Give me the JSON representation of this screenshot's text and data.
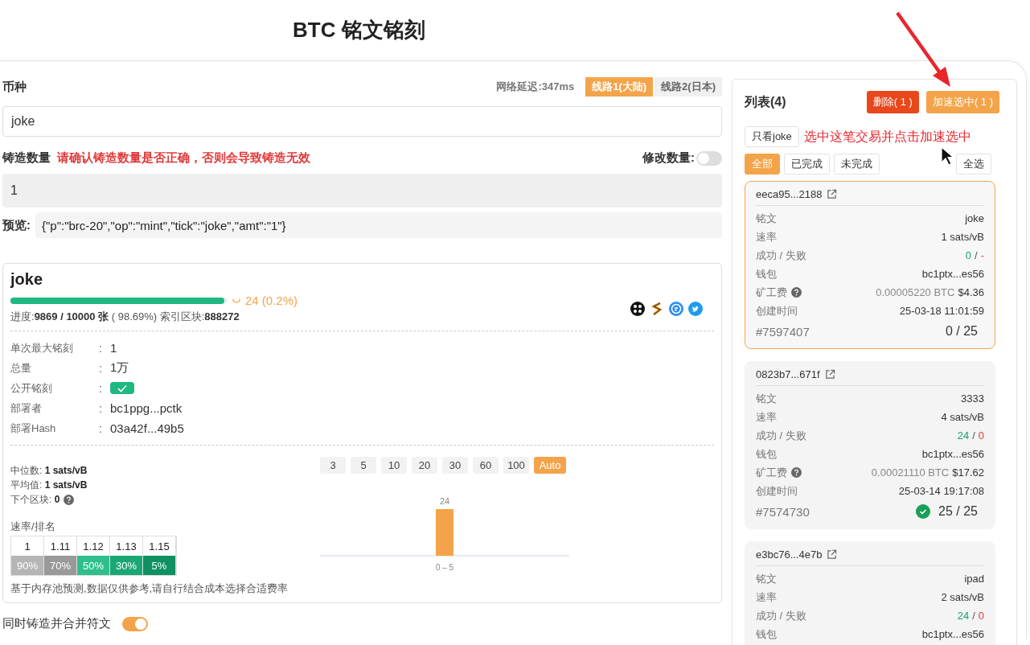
{
  "title": "BTC 铭文铭刻",
  "form": {
    "coin_label": "币种",
    "latency": "网络延迟:347ms",
    "routes": [
      {
        "label": "线路1(大陆)",
        "selected": true
      },
      {
        "label": "线路2(日本)",
        "selected": false
      }
    ],
    "coin_value": "joke",
    "amount_label": "铸造数量",
    "amount_warning": "请确认铸造数量是否正确，否则会导致铸造无效",
    "modify_label": "修改数量:",
    "modify_on": false,
    "amount_value": "1",
    "preview_label": "预览:",
    "preview_value": "{\"p\":\"brc-20\",\"op\":\"mint\",\"tick\":\"joke\",\"amt\":\"1\"}"
  },
  "token": {
    "name": "joke",
    "progress": {
      "level": 0.9869,
      "pending": "24 (0.2%)"
    },
    "progress_text": "进度:**9869 / 10000 张** ( 98.69%)  索引区块:**888272**",
    "details": [
      {
        "kind": "text",
        "label": "单次最大铭刻",
        "colon": ":",
        "value": "1"
      },
      {
        "kind": "text",
        "label": "总量",
        "colon": ":",
        "value": "1万"
      },
      {
        "kind": "check",
        "label": "公开铭刻",
        "colon": ":",
        "checked": true
      },
      {
        "kind": "text",
        "label": "部署者",
        "colon": ":",
        "value": "bc1ppg...pctk"
      },
      {
        "kind": "text",
        "label": "部署Hash",
        "colon": ":",
        "value": "03a42f...49b5"
      }
    ],
    "stats": [
      {
        "text": "中位数: **1 sats/vB**"
      },
      {
        "text": "平均值: **1 sats/vB**"
      },
      {
        "text": "下个区块: **0**",
        "help": true
      }
    ],
    "rank_label": "速率/排名",
    "ranks": [
      {
        "rate": "1",
        "rank": "90%",
        "color": "#b5b5b5"
      },
      {
        "rate": "1.11",
        "rank": "70%",
        "color": "#999999"
      },
      {
        "rate": "1.12",
        "rank": "50%",
        "color": "#2fbf8c"
      },
      {
        "rate": "1.13",
        "rank": "30%",
        "color": "#19a874"
      },
      {
        "rate": "1.15",
        "rank": "5%",
        "color": "#0e9160"
      }
    ],
    "fee_options": [
      {
        "label": "3",
        "selected": false
      },
      {
        "label": "5",
        "selected": false
      },
      {
        "label": "10",
        "selected": false
      },
      {
        "label": "20",
        "selected": false
      },
      {
        "label": "30",
        "selected": false
      },
      {
        "label": "60",
        "selected": false
      },
      {
        "label": "100",
        "selected": false
      },
      {
        "label": "Auto",
        "selected": true
      }
    ],
    "chart_data": {
      "type": "bar",
      "categories": [
        "0 – 5"
      ],
      "values": [
        24
      ],
      "data_labels": true
    },
    "note": "基于内存池预测,数据仅供参考,请自行结合成本选择合适费率"
  },
  "merge": {
    "label": "同时铸造并合并符文",
    "on": true
  },
  "list": {
    "title": "列表(4)",
    "actions": [
      {
        "kind": "danger",
        "label": "删除( 1 )"
      },
      {
        "kind": "primary",
        "label": "加速选中( 1 )"
      }
    ],
    "filter": "只看joke",
    "annotation": "选中这笔交易并点击加速选中",
    "tabs": [
      {
        "label": "全部",
        "selected": true
      },
      {
        "label": "已完成",
        "selected": false
      },
      {
        "label": "未完成",
        "selected": false
      }
    ],
    "select_all": "全选",
    "orders": [
      {
        "hash": "eeca95...2188",
        "selected": true,
        "fields": [
          {
            "kind": "text",
            "label": "铭文",
            "value": "joke"
          },
          {
            "kind": "text",
            "label": "速率",
            "value": "1 sats/vB"
          },
          {
            "kind": "result",
            "label": "成功 / 失败",
            "success": "0",
            "separator": "/",
            "fail": "-"
          },
          {
            "kind": "text",
            "label": "钱包",
            "value": "bc1ptx...es56"
          },
          {
            "kind": "fee",
            "label": "矿工费",
            "help": true,
            "btc": "0.00005220 BTC",
            "usd": "$4.36"
          },
          {
            "kind": "text",
            "label": "创建时间",
            "value": "25-03-18 11:01:59"
          }
        ],
        "id": "#7597407",
        "count": "0 / 25",
        "complete": false
      },
      {
        "hash": "0823b7...671f",
        "selected": false,
        "fields": [
          {
            "kind": "text",
            "label": "铭文",
            "value": "3333"
          },
          {
            "kind": "text",
            "label": "速率",
            "value": "4 sats/vB"
          },
          {
            "kind": "result",
            "label": "成功 / 失败",
            "success": "24",
            "separator": "/",
            "fail": "0"
          },
          {
            "kind": "text",
            "label": "钱包",
            "value": "bc1ptx...es56"
          },
          {
            "kind": "fee",
            "label": "矿工费",
            "help": true,
            "btc": "0.00021110 BTC",
            "usd": "$17.62"
          },
          {
            "kind": "text",
            "label": "创建时间",
            "value": "25-03-14 19:17:08"
          }
        ],
        "id": "#7574730",
        "count": "25 / 25",
        "complete": true
      },
      {
        "hash": "e3bc76...4e7b",
        "selected": false,
        "fields": [
          {
            "kind": "text",
            "label": "铭文",
            "value": "ipad"
          },
          {
            "kind": "text",
            "label": "速率",
            "value": "2 sats/vB"
          },
          {
            "kind": "result",
            "label": "成功 / 失败",
            "success": "24",
            "separator": "/",
            "fail": "0"
          },
          {
            "kind": "text",
            "label": "钱包",
            "value": "bc1ptx...es56"
          }
        ]
      }
    ]
  }
}
